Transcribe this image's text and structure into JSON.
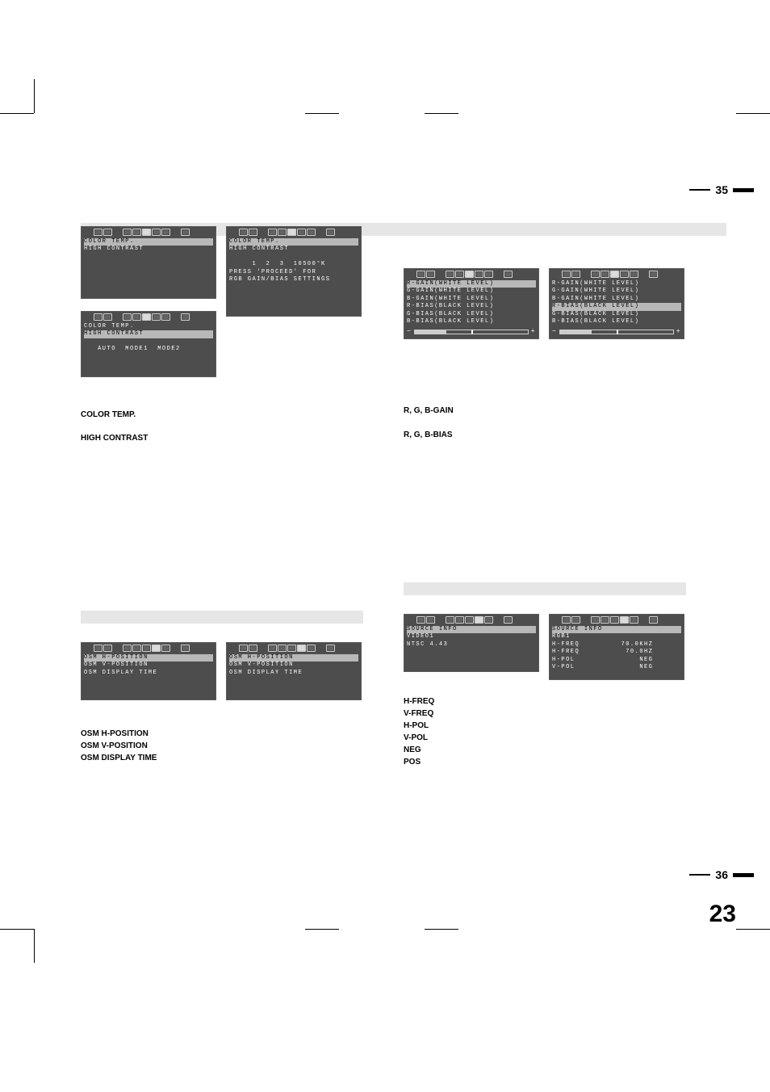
{
  "page_rule_35": "35",
  "page_rule_36": "36",
  "big_page": "23",
  "panel_a": {
    "l1": "COLOR TEMP.",
    "l2": "HIGH CONTRAST"
  },
  "panel_b": {
    "l1": "COLOR TEMP.",
    "l2": "HIGH CONTRAST",
    "l3": "   AUTO  MODE1  MODE2"
  },
  "panel_c": {
    "l1": "COLOR TEMP.",
    "l2": "HIGH CONTRAST",
    "l3": "     1  2  3  10500°K",
    "l4": "PRESS 'PROCEED' FOR",
    "l5": "RGB GAIN/BIAS SETTINGS"
  },
  "panel_d": {
    "l1": "R-GAIN(WHITE LEVEL)",
    "l2": "G-GAIN(WHITE LEVEL)",
    "l3": "B-GAIN(WHITE LEVEL)",
    "l4": "R-BIAS(BLACK LEVEL)",
    "l5": "G-BIAS(BLACK LEVEL)",
    "l6": "B-BIAS(BLACK LEVEL)"
  },
  "panel_e": {
    "l1": "R-GAIN(WHITE LEVEL)",
    "l2": "G-GAIN(WHITE LEVEL)",
    "l3": "B-GAIN(WHITE LEVEL)",
    "l4": "R-BIAS(BLACK LEVEL)",
    "l5": "G-BIAS(BLACK LEVEL)",
    "l6": "B-BIAS(BLACK LEVEL)"
  },
  "gloss_left_1": "COLOR TEMP.",
  "gloss_left_2": "HIGH CONTRAST",
  "gloss_right_1": "R, G, B-GAIN",
  "gloss_right_2": "R, G, B-BIAS",
  "panel_f": {
    "l1": "OSM H-POSITION",
    "l2": "OSM V-POSITION",
    "l3": "OSM DISPLAY TIME"
  },
  "panel_g": {
    "l1": "OSM H-POSITION",
    "l2": "OSM V-POSITION",
    "l3": "OSM DISPLAY TIME"
  },
  "panel_h": {
    "l1": "SOURCE INFO",
    "l2": "VIDEO1",
    "l3": "NTSC 4.43"
  },
  "panel_i": {
    "l1": "SOURCE INFO",
    "l2": "RGB1",
    "l3": "H-FREQ         70.0KHZ",
    "l4": "H-FREQ          70.0HZ",
    "l5": "H-POL              NEG",
    "l6": "V-POL              NEG"
  },
  "gloss_bl_1": "OSM H-POSITION",
  "gloss_bl_2": "OSM V-POSITION",
  "gloss_bl_3": "OSM DISPLAY TIME",
  "gloss_br_1": "H-FREQ",
  "gloss_br_2": "V-FREQ",
  "gloss_br_3": "H-POL",
  "gloss_br_4": "V-POL",
  "gloss_br_5": "NEG",
  "gloss_br_6": "POS"
}
